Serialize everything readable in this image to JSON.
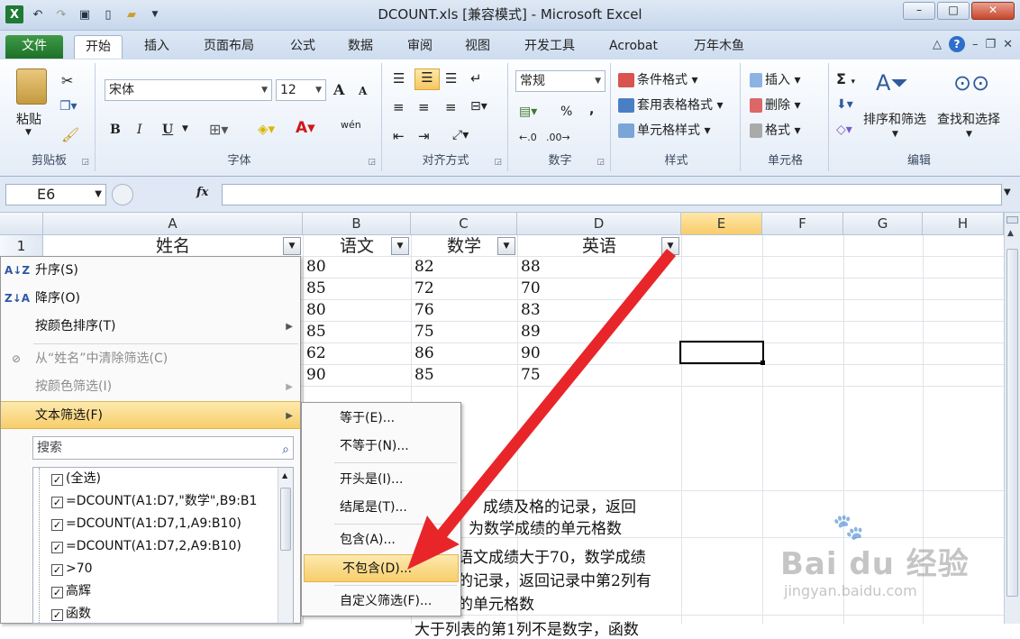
{
  "window": {
    "title": "DCOUNT.xls  [兼容模式] - Microsoft Excel"
  },
  "tabs": [
    "文件",
    "开始",
    "插入",
    "页面布局",
    "公式",
    "数据",
    "审阅",
    "视图",
    "开发工具",
    "Acrobat",
    "万年木鱼"
  ],
  "ribbon": {
    "clipboard": {
      "paste": "粘贴",
      "label": "剪贴板"
    },
    "font": {
      "name": "宋体",
      "size": "12",
      "label": "字体",
      "bold": "B",
      "italic": "I",
      "underline": "U",
      "wen": "wén",
      "big": "A",
      "small": "A"
    },
    "alignment": {
      "label": "对齐方式"
    },
    "number": {
      "format": "常规",
      "label": "数字",
      "percent": "%",
      "comma": ","
    },
    "styles": {
      "cond": "条件格式",
      "table": "套用表格格式",
      "cell": "单元格样式",
      "label": "样式"
    },
    "cells": {
      "insert": "插入",
      "delete": "删除",
      "format": "格式",
      "label": "单元格"
    },
    "editing": {
      "sum": "Σ",
      "sort": "排序和筛选",
      "find": "查找和选择",
      "label": "编辑"
    }
  },
  "formula": {
    "namebox": "E6",
    "fx": "fx"
  },
  "columns": [
    "A",
    "B",
    "C",
    "D",
    "E",
    "F",
    "G",
    "H"
  ],
  "row1": {
    "num": "1",
    "a": "姓名",
    "b": "语文",
    "c": "数学",
    "d": "英语"
  },
  "data": [
    [
      "80",
      "82",
      "88"
    ],
    [
      "85",
      "72",
      "70"
    ],
    [
      "80",
      "76",
      "83"
    ],
    [
      "85",
      "75",
      "89"
    ],
    [
      "62",
      "86",
      "90"
    ],
    [
      "90",
      "85",
      "75"
    ]
  ],
  "lowertext": [
    "成绩及格的记录，返回",
    "为数学成绩的单元格数",
    "语文成绩大于70，数学成绩",
    "的记录，返回记录中第2列有",
    "的单元格数",
    "大于列表的第1列不是数字，函数"
  ],
  "menu": {
    "items": [
      {
        "label": "升序(S)",
        "icon": "A↓Z"
      },
      {
        "label": "降序(O)",
        "icon": "Z↓A"
      },
      {
        "label": "按颜色排序(T)"
      },
      {
        "label": "从“姓名”中清除筛选(C)"
      },
      {
        "label": "按颜色筛选(I)"
      },
      {
        "label": "文本筛选(F)"
      }
    ],
    "search": "搜索",
    "list": [
      "(全选)",
      "=DCOUNT(A1:D7,\"数学\",B9:B1",
      "=DCOUNT(A1:D7,1,A9:B10)",
      "=DCOUNT(A1:D7,2,A9:B10)",
      ">70",
      "高辉",
      "函数"
    ]
  },
  "submenu": [
    "等于(E)...",
    "不等于(N)...",
    "开头是(I)...",
    "结尾是(T)...",
    "包含(A)...",
    "不包含(D)...",
    "自定义筛选(F)..."
  ],
  "watermark": {
    "brand": "Bai du 经验",
    "url": "jingyan.baidu.com"
  },
  "colors": {
    "arrow": "#e8262a",
    "highlight": "#f7ce6b",
    "selected_header": "#f8cc6a"
  }
}
